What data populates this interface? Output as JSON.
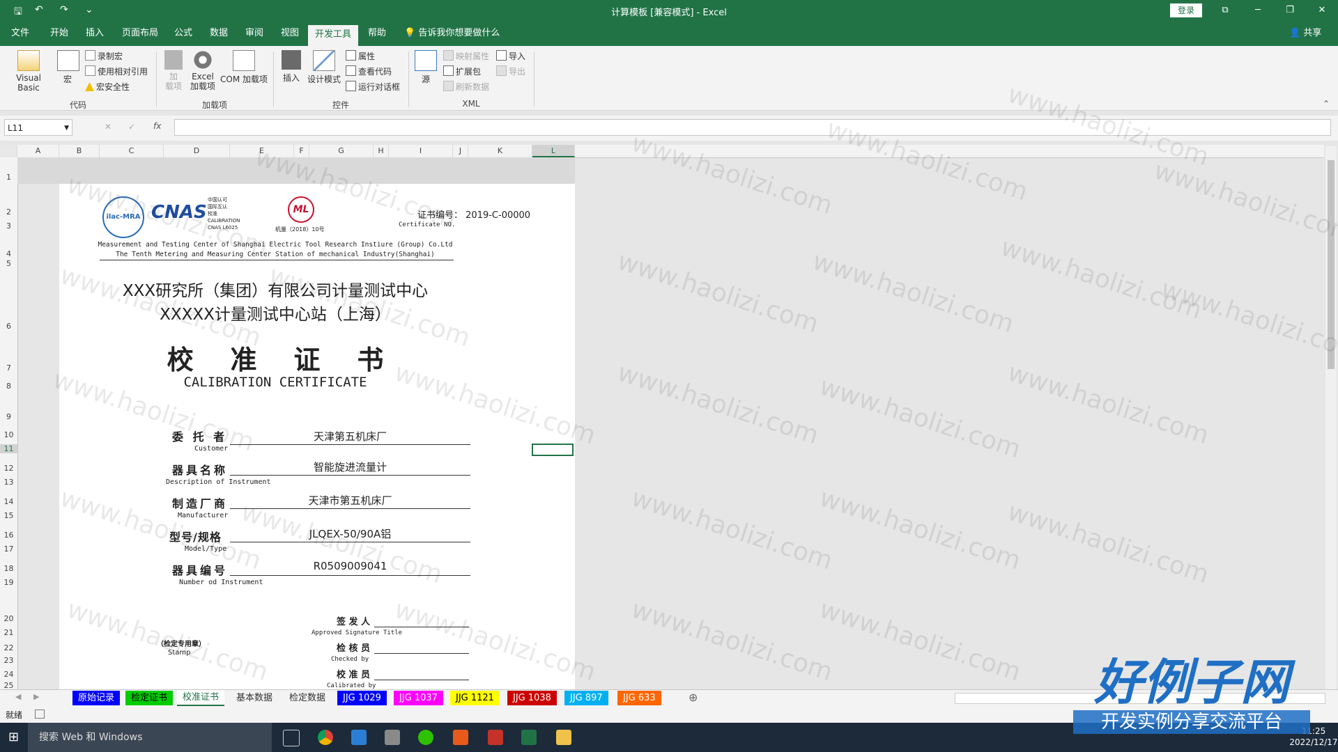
{
  "titlebar": {
    "title": "计算模板  [兼容模式]  -  Excel",
    "login": "登录",
    "qa_save": "🖫",
    "qa_undo": "↶",
    "qa_redo": "↷",
    "qa_more": "⌄",
    "win_restore": "⧉",
    "win_min": "─",
    "win_max": "❐",
    "win_close": "✕"
  },
  "menu": {
    "tabs": [
      "文件",
      "开始",
      "插入",
      "页面布局",
      "公式",
      "数据",
      "审阅",
      "视图",
      "开发工具",
      "帮助"
    ],
    "active": "开发工具",
    "tellme": "告诉我你想要做什么",
    "share": "共享"
  },
  "ribbon": {
    "code": {
      "label": "代码",
      "visual_basic": "Visual Basic",
      "macros": "宏",
      "record": "录制宏",
      "relative": "使用相对引用",
      "security": "宏安全性"
    },
    "addins": {
      "label": "加载项",
      "addins": "加\n载项",
      "excel_addins": "Excel\n加载项",
      "com_addins": "COM 加载项"
    },
    "controls": {
      "label": "控件",
      "insert": "插入",
      "design": "设计模式",
      "properties": "属性",
      "view_code": "查看代码",
      "run_dialog": "运行对话框"
    },
    "xml": {
      "label": "XML",
      "source": "源",
      "map_props": "映射属性",
      "expansion": "扩展包",
      "refresh": "刷新数据",
      "import": "导入",
      "export": "导出"
    }
  },
  "formula_bar": {
    "name_box": "L11",
    "cancel": "✕",
    "enter": "✓",
    "fx": "fx",
    "value": ""
  },
  "grid": {
    "columns": [
      "A",
      "B",
      "C",
      "D",
      "E",
      "F",
      "G",
      "H",
      "I",
      "J",
      "K",
      "L"
    ],
    "rows": [
      "1",
      "2",
      "3",
      "4",
      "5",
      "6",
      "7",
      "8",
      "9",
      "10",
      "11",
      "12",
      "13",
      "14",
      "15",
      "16",
      "17",
      "18",
      "19",
      "20",
      "21",
      "22",
      "23",
      "24",
      "25"
    ],
    "selected_cell": "L11"
  },
  "certificate": {
    "logo1": "ilac-MRA",
    "logo2": "CNAS",
    "logo2_text": [
      "中国认可",
      "国际互认",
      "校准",
      "CALIBRATION",
      "CNAS L6025"
    ],
    "logo3": "ML",
    "logo3_text": "机量（2018）10号",
    "cert_no_label": "证书编号：",
    "cert_no": "2019-C-00000",
    "cert_no_en": "Certificate NO.",
    "org_en_1": "Measurement and Testing Center of Shanghai Electric Tool Research Instiure (Group) Co.Ltd",
    "org_en_2": "The Tenth Metering and Measuring Center Station of mechanical Industry(Shanghai)",
    "org_cn_1": "XXX研究所（集团）有限公司计量测试中心",
    "org_cn_2": "XXXXX计量测试中心站（上海）",
    "title_cn": "校    准    证    书",
    "title_en": "CALIBRATION CERTIFICATE",
    "fields": [
      {
        "label": "委 托 者",
        "label_en": "Customer",
        "value": "天津第五机床厂"
      },
      {
        "label": "器具名称",
        "label_en": "Description of Instrument",
        "value": "智能旋进流量计"
      },
      {
        "label": "制造厂商",
        "label_en": "Manufacturer",
        "value": "天津市第五机床厂"
      },
      {
        "label": "型号/规格",
        "label_en": "Model/Type",
        "value": "JLQEX-50/90A铝"
      },
      {
        "label": "器具编号",
        "label_en": "Number od Instrument",
        "value": "R0509009041"
      }
    ],
    "stamp": "（检定专用章）",
    "stamp_en": "Stamp",
    "approver": "签 发 人",
    "approver_en": "Approved Signature Title",
    "checker": "检 核 员",
    "checker_en": "Checked by",
    "calibrator": "校 准 员",
    "calibrator_en": "Calibrated by"
  },
  "watermark": "www.haolizi.com",
  "sheets": [
    {
      "name": "原始记录",
      "color": "#0000ff",
      "text": "#ffffff"
    },
    {
      "name": "检定证书",
      "color": "#00cc00",
      "text": "#000000"
    },
    {
      "name": "校准证书",
      "color": "#ffffff",
      "text": "#217346",
      "active": true
    },
    {
      "name": "基本数据",
      "color": "#f3f3f3",
      "text": "#333333"
    },
    {
      "name": "检定数据",
      "color": "#f3f3f3",
      "text": "#333333"
    },
    {
      "name": "JJG 1029",
      "color": "#0000ff",
      "text": "#ffffff"
    },
    {
      "name": "JJG 1037",
      "color": "#ff00ff",
      "text": "#ffffff"
    },
    {
      "name": "JJG 1121",
      "color": "#ffff00",
      "text": "#000000"
    },
    {
      "name": "JJG 1038",
      "color": "#cc0000",
      "text": "#ffffff"
    },
    {
      "name": "JJG 897",
      "color": "#00b0f0",
      "text": "#ffffff"
    },
    {
      "name": "JJG 633",
      "color": "#ff6600",
      "text": "#ffffff"
    }
  ],
  "status": {
    "ready": "就绪"
  },
  "taskbar": {
    "search": "搜索 Web 和 Windows",
    "time": "11:25",
    "date": "2022/12/17"
  },
  "brand": {
    "line1": "好例子网",
    "line2": "开发实例分享交流平台"
  },
  "colors": {
    "excel_green": "#217346",
    "ribbon_bg": "#f3f3f3"
  }
}
